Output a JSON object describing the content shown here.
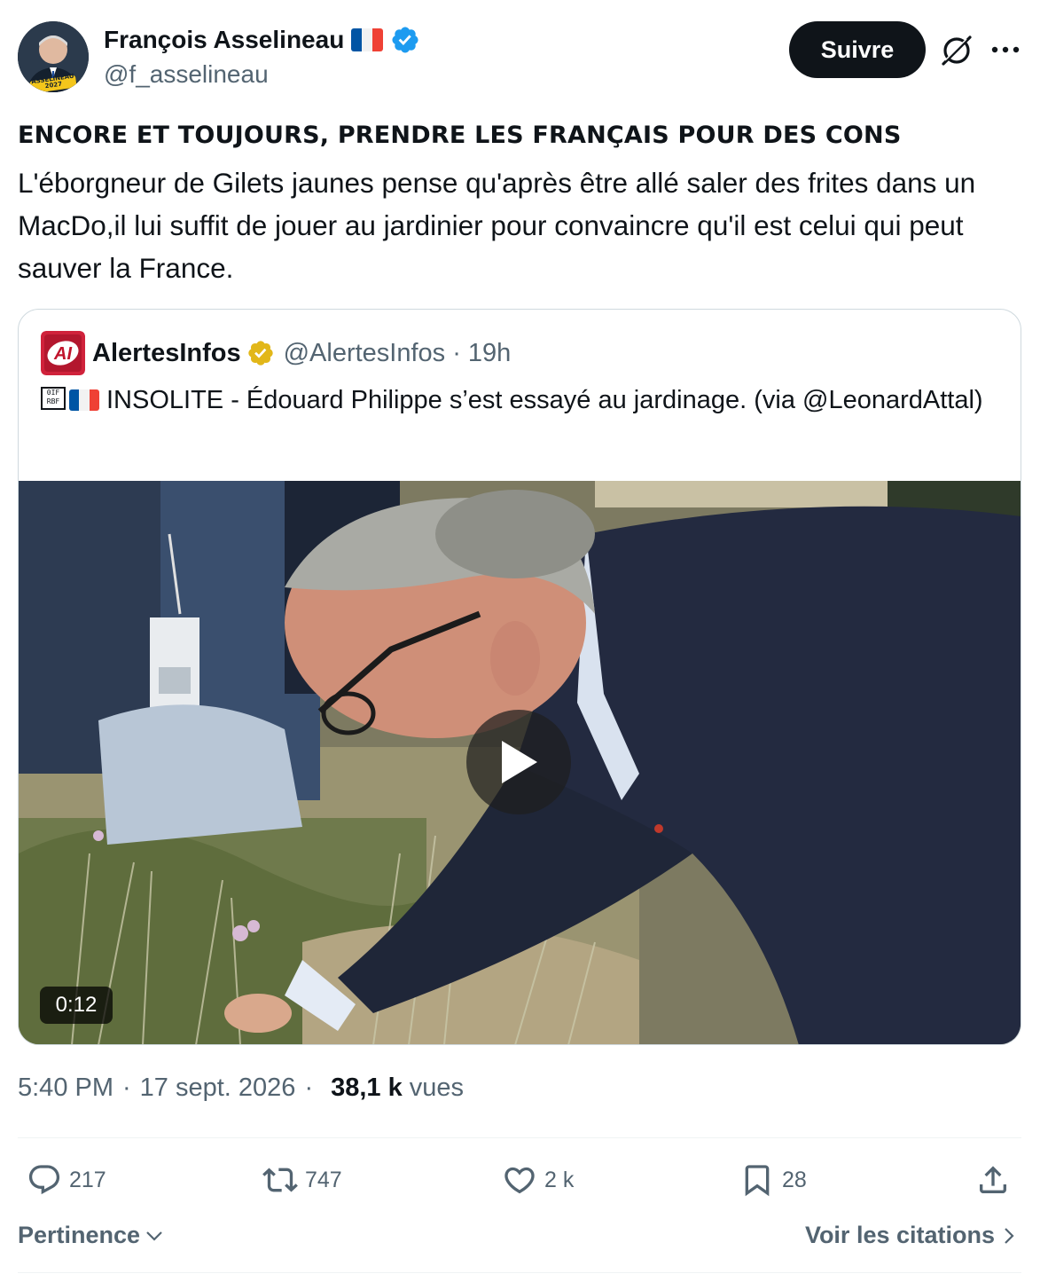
{
  "author": {
    "name": "François Asselineau",
    "handle": "@f_asselineau",
    "avatar_caption": "ASSELINEAU 2027",
    "flag_colors": [
      "#0055A4",
      "#FFFFFF",
      "#EF4135"
    ],
    "verified_color": "#1d9bf0"
  },
  "follow_button": {
    "label": "Suivre"
  },
  "icons": {
    "grok": "grok-slash-icon",
    "more": "more-dots-icon"
  },
  "post": {
    "headline": "ENCORE ET TOUJOURS, PRENDRE LES FRANÇAIS POUR DES CONS",
    "body": "L'éborgneur de Gilets jaunes pense qu'après être allé saler des frites dans un MacDo,il lui suffit de jouer au jardinier pour convaincre qu'il est celui qui peut sauver la France."
  },
  "quote": {
    "name": "AlertesInfos",
    "handle": "@AlertesInfos",
    "separator": "·",
    "time": "19h",
    "badge_color": "#e2b719",
    "avatar_text": "AI",
    "glyph": "0IF\nRBF",
    "text": "INSOLITE - Édouard Philippe s’est essayé au jardinage. (via @LeonardAttal)",
    "video_duration": "0:12"
  },
  "meta": {
    "time": "5:40 PM",
    "date": "17 sept. 2026",
    "separator": "·",
    "views_count": "38,1 k",
    "views_label": "vues"
  },
  "actions": {
    "replies": "217",
    "reposts": "747",
    "likes": "2 k",
    "bookmarks": "28"
  },
  "footer": {
    "sort_label": "Pertinence",
    "quotes_link": "Voir les citations"
  }
}
